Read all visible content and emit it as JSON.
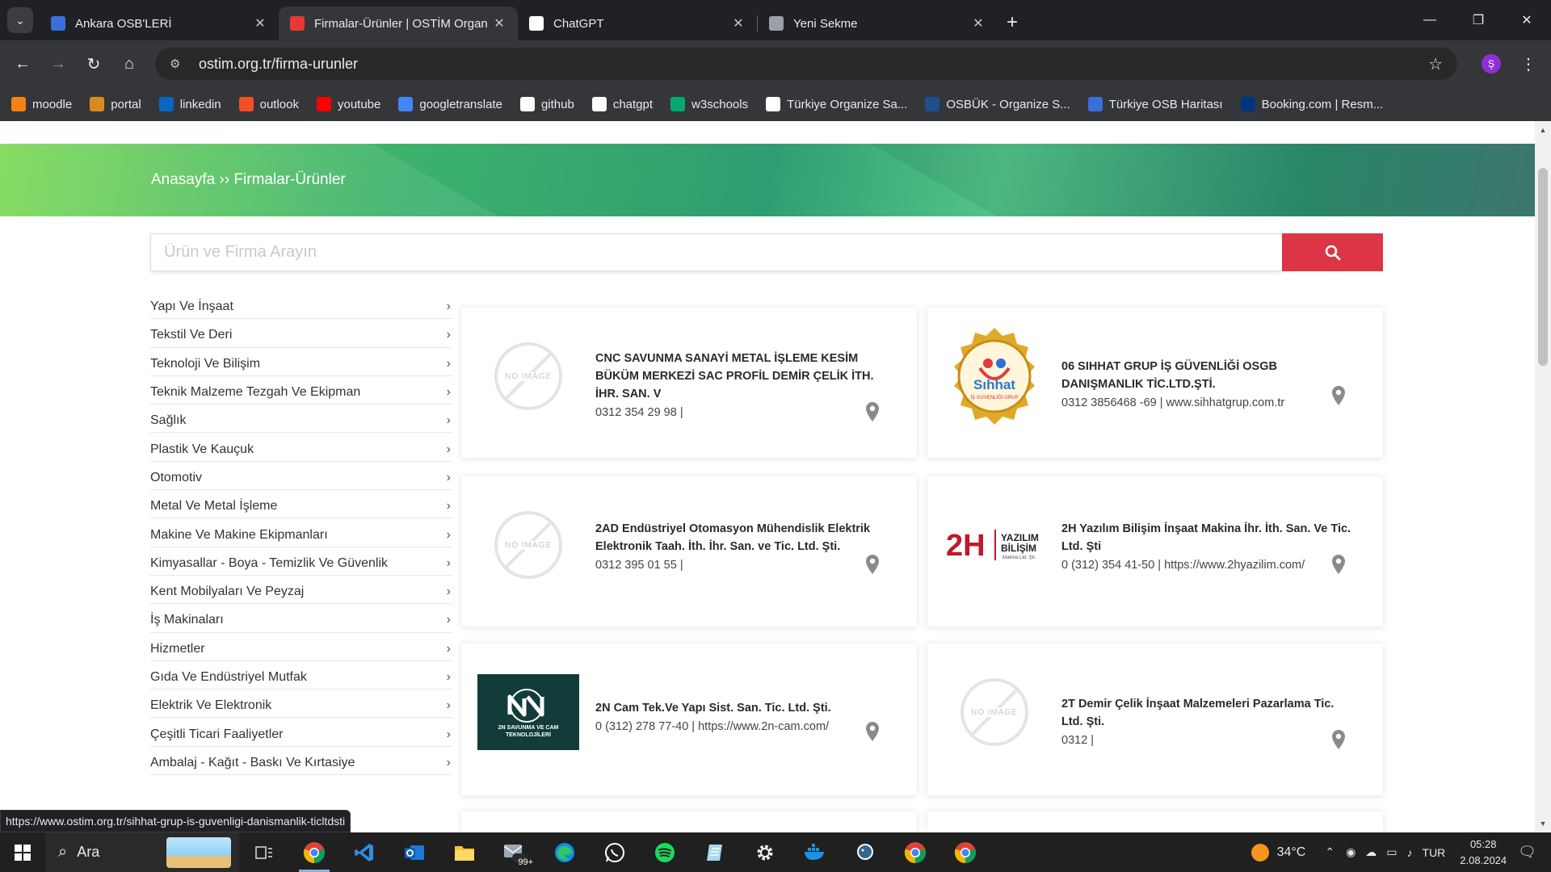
{
  "browser": {
    "tabs": [
      {
        "title": "Ankara OSB'LERİ",
        "favicon_color": "#3b6fd8",
        "active": false
      },
      {
        "title": "Firmalar-Ürünler | OSTİM Organ",
        "favicon_color": "#e53935",
        "active": true
      },
      {
        "title": "ChatGPT",
        "favicon_color": "#ffffff",
        "active": false
      },
      {
        "title": "Yeni Sekme",
        "favicon_color": "#9aa0a6",
        "active": false
      }
    ],
    "url": "ostim.org.tr/firma-urunler",
    "profile_initial": "Ş",
    "bookmarks": [
      {
        "label": "moodle",
        "color": "#f98012"
      },
      {
        "label": "portal",
        "color": "#d98a1f"
      },
      {
        "label": "linkedin",
        "color": "#0a66c2"
      },
      {
        "label": "outlook",
        "color": "#f25022"
      },
      {
        "label": "youtube",
        "color": "#ff0000"
      },
      {
        "label": "googletranslate",
        "color": "#4285f4"
      },
      {
        "label": "github",
        "color": "#ffffff"
      },
      {
        "label": "chatgpt",
        "color": "#ffffff"
      },
      {
        "label": "w3schools",
        "color": "#04aa6d"
      },
      {
        "label": "Türkiye Organize Sa...",
        "color": "#ffffff"
      },
      {
        "label": "OSBÜK - Organize S...",
        "color": "#1f4e8c"
      },
      {
        "label": "Türkiye OSB Haritası",
        "color": "#3b6fd8"
      },
      {
        "label": "Booking.com | Resm...",
        "color": "#003580"
      }
    ]
  },
  "page": {
    "breadcrumb": "Anasayfa ›› Firmalar-Ürünler",
    "search_placeholder": "Ürün ve Firma Arayın",
    "categories": [
      "Yapı Ve İnşaat",
      "Tekstil Ve Deri",
      "Teknoloji Ve Bilişim",
      "Teknik Malzeme Tezgah Ve Ekipman",
      "Sağlık",
      "Plastik Ve Kauçuk",
      "Otomotiv",
      "Metal Ve Metal İşleme",
      "Makine Ve Makine Ekipmanları",
      "Kimyasallar - Boya - Temizlik Ve Güvenlik",
      "Kent Mobilyaları Ve Peyzaj",
      "İş Makinaları",
      "Hizmetler",
      "Gıda Ve Endüstriyel Mutfak",
      "Elektrik Ve Elektronik",
      "Çeşitli Ticari Faaliyetler",
      "Ambalaj - Kağıt - Baskı Ve Kırtasiye"
    ],
    "companies": [
      {
        "name": "CNC SAVUNMA SANAYİ METAL İŞLEME KESİM BÜKÜM MERKEZİ SAC PROFİL DEMİR ÇELİK İTH. İHR. SAN. V",
        "contact": "0312 354 29 98 |",
        "logo": "noimage"
      },
      {
        "name": "06 SIHHAT GRUP İŞ GÜVENLİĞİ OSGB DANIŞMANLIK TİC.LTD.ŞTİ.",
        "contact": "0312 3856468 -69 | www.sihhatgrup.com.tr",
        "logo": "sihhat"
      },
      {
        "name": "2AD Endüstriyel Otomasyon Mühendislik Elektrik Elektronik Taah. İth. İhr. San. ve Tic. Ltd. Şti.",
        "contact": "0312 395 01 55 |",
        "logo": "noimage"
      },
      {
        "name": "2H Yazılım Bilişim İnşaat Makina İhr. İth. San. Ve Tic. Ltd. Şti",
        "contact": "0 (312) 354 41-50 | https://www.2hyazilim.com/",
        "logo": "2h"
      },
      {
        "name": "2N Cam Tek.Ve Yapı Sist. San. Tic. Ltd. Şti.",
        "contact": "0 (312) 278 77-40 | https://www.2n-cam.com/",
        "logo": "2n"
      },
      {
        "name": "2T Demir Çelik İnşaat Malzemeleri Pazarlama Tic. Ltd. Şti.",
        "contact": "0312 |",
        "logo": "noimage"
      }
    ],
    "no_image_text": "NO IMAGE",
    "sihhat_logo_text": "Sıhhat",
    "sihhat_logo_sub": "İŞ GÜVENLİĞİ GRUP",
    "yazilim_logo_text": "YAZILIM",
    "bilisim_logo_text": "BİLİŞİM",
    "makina_logo_text": "Makina Ltd. Şti.",
    "twon_logo_text": "2N SAVUNMA VE CAM TEKNOLOJİLERİ"
  },
  "status_url": "https://www.ostim.org.tr/sihhat-grup-is-guvenligi-danismanlik-ticltdsti",
  "taskbar": {
    "search_label": "Ara",
    "weather": "34°C",
    "language": "TUR",
    "time": "05:28",
    "date": "2.08.2024",
    "notification_badge": "99+"
  }
}
